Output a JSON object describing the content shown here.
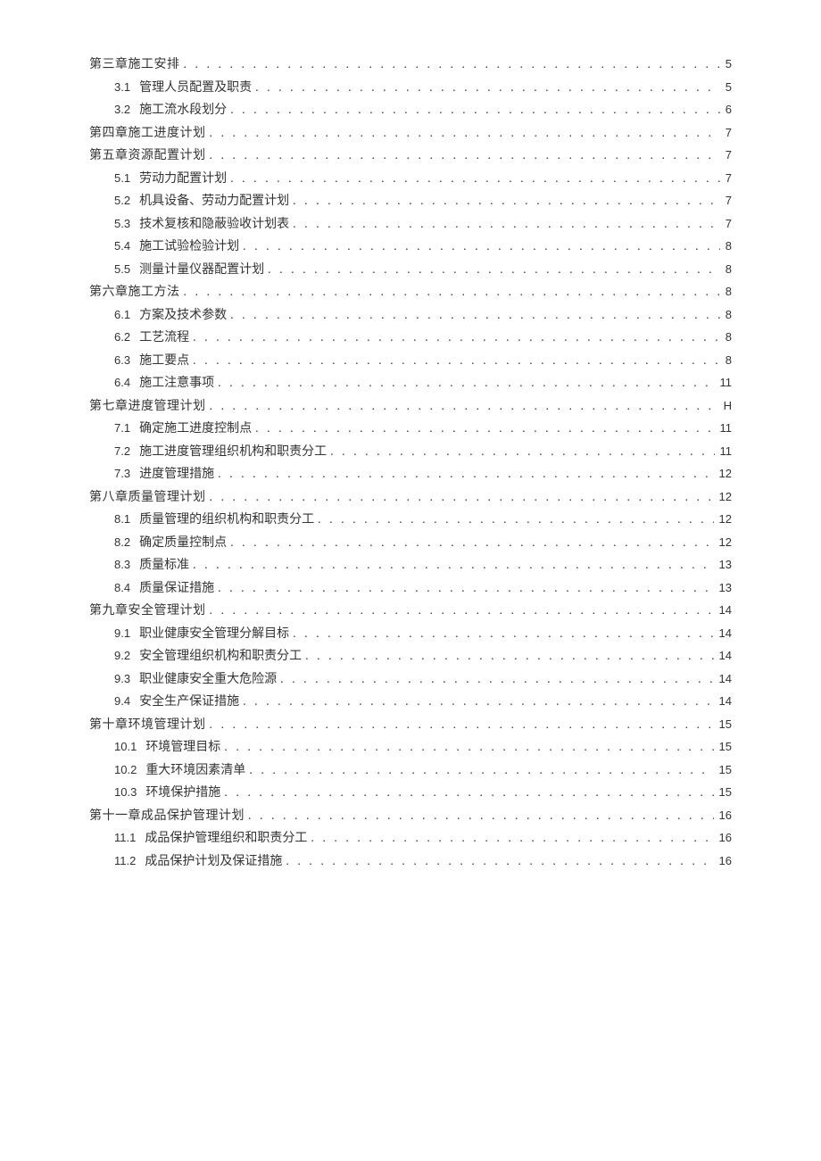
{
  "toc": [
    {
      "level": 1,
      "num": "",
      "title": "第三章施工安排",
      "page": "5"
    },
    {
      "level": 2,
      "num": "3.1",
      "title": "管理人员配置及职责",
      "page": "5"
    },
    {
      "level": 2,
      "num": "3.2",
      "title": "施工流水段划分",
      "page": "6"
    },
    {
      "level": 1,
      "num": "",
      "title": "第四章施工进度计划",
      "page": "7"
    },
    {
      "level": 1,
      "num": "",
      "title": "第五章资源配置计划",
      "page": "7"
    },
    {
      "level": 2,
      "num": "5.1",
      "title": "劳动力配置计划",
      "page": "7"
    },
    {
      "level": 2,
      "num": "5.2",
      "title": "机具设备、劳动力配置计划",
      "page": "7"
    },
    {
      "level": 2,
      "num": "5.3",
      "title": "技术复核和隐蔽验收计划表",
      "page": "7"
    },
    {
      "level": 2,
      "num": "5.4",
      "title": "施工试验检验计划",
      "page": "8"
    },
    {
      "level": 2,
      "num": "5.5",
      "title": "测量计量仪器配置计划",
      "page": "8"
    },
    {
      "level": 1,
      "num": "",
      "title": "第六章施工方法",
      "page": "8"
    },
    {
      "level": 2,
      "num": "6.1",
      "title": "方案及技术参数",
      "page": "8"
    },
    {
      "level": 2,
      "num": "6.2",
      "title": "工艺流程",
      "page": "8"
    },
    {
      "level": 2,
      "num": "6.3",
      "title": "施工要点",
      "page": "8"
    },
    {
      "level": 2,
      "num": "6.4",
      "title": "施工注意事项",
      "page": "11"
    },
    {
      "level": 1,
      "num": "",
      "title": "第七章进度管理计划",
      "page": "H"
    },
    {
      "level": 2,
      "num": "7.1",
      "title": "确定施工进度控制点",
      "page": "11"
    },
    {
      "level": 2,
      "num": "7.2",
      "title": "施工进度管理组织机构和职责分工",
      "page": "11"
    },
    {
      "level": 2,
      "num": "7.3",
      "title": "进度管理措施",
      "page": "12"
    },
    {
      "level": 1,
      "num": "",
      "title": "第八章质量管理计划",
      "page": "12"
    },
    {
      "level": 2,
      "num": "8.1",
      "title": "质量管理的组织机构和职责分工",
      "page": "12"
    },
    {
      "level": 2,
      "num": "8.2",
      "title": "确定质量控制点",
      "page": "12"
    },
    {
      "level": 2,
      "num": "8.3",
      "title": "质量标准",
      "page": "13"
    },
    {
      "level": 2,
      "num": "8.4",
      "title": "质量保证措施",
      "page": "13"
    },
    {
      "level": 1,
      "num": "",
      "title": "第九章安全管理计划",
      "page": "14"
    },
    {
      "level": 2,
      "num": "9.1",
      "title": "职业健康安全管理分解目标",
      "page": "14"
    },
    {
      "level": 2,
      "num": "9.2",
      "title": "安全管理组织机构和职责分工",
      "page": "14"
    },
    {
      "level": 2,
      "num": "9.3",
      "title": "职业健康安全重大危险源",
      "page": "14"
    },
    {
      "level": 2,
      "num": "9.4",
      "title": "安全生产保证措施",
      "page": "14"
    },
    {
      "level": 1,
      "num": "",
      "title": "第十章环境管理计划",
      "page": "15"
    },
    {
      "level": 2,
      "num": "10.1",
      "title": "环境管理目标",
      "page": "15"
    },
    {
      "level": 2,
      "num": "10.2",
      "title": "重大环境因素清单",
      "page": "15"
    },
    {
      "level": 2,
      "num": "10.3",
      "title": "环境保护措施",
      "page": "15"
    },
    {
      "level": 1,
      "num": "",
      "title": "第十一章成品保护管理计划",
      "page": "16"
    },
    {
      "level": 2,
      "num": "11.1",
      "title": "成品保护管理组织和职责分工",
      "page": "16"
    },
    {
      "level": 2,
      "num": "11.2",
      "title": "成品保护计划及保证措施",
      "page": "16"
    }
  ]
}
